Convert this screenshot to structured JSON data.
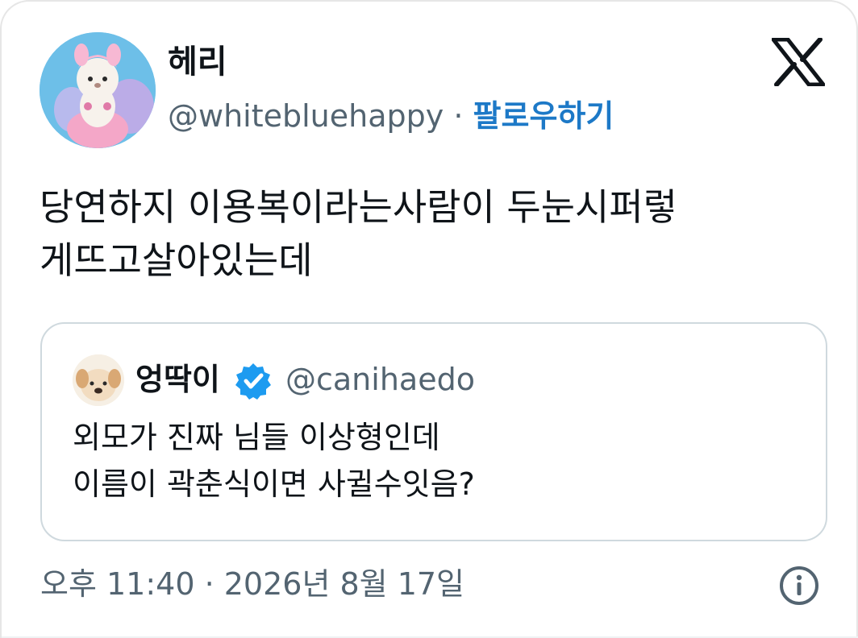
{
  "author": {
    "display_name": "헤리",
    "handle": "@whitebluehappy",
    "separator": "·",
    "follow_label": "팔로우하기"
  },
  "brand": {
    "logo_icon": "x-logo-icon"
  },
  "tweet": {
    "lines": [
      "당연하지 이용복이라는사람이 두눈시퍼렇",
      "게뜨고살아있는데"
    ],
    "timestamp": "오후 11:40 · 2026년 8월 17일"
  },
  "quoted_tweet": {
    "display_name": "엉딱이",
    "handle": "@canihaedo",
    "verified_icon": "verified-badge-icon",
    "lines": [
      "외모가 진짜 님들 이상형인데",
      "이름이 곽춘식이면 사귈수잇음?"
    ]
  },
  "colors": {
    "text": "#0f1419",
    "secondary_text": "#536471",
    "follow_link": "#1d79c7",
    "verified": "#1d9bf0",
    "border": "#cfd9de"
  }
}
